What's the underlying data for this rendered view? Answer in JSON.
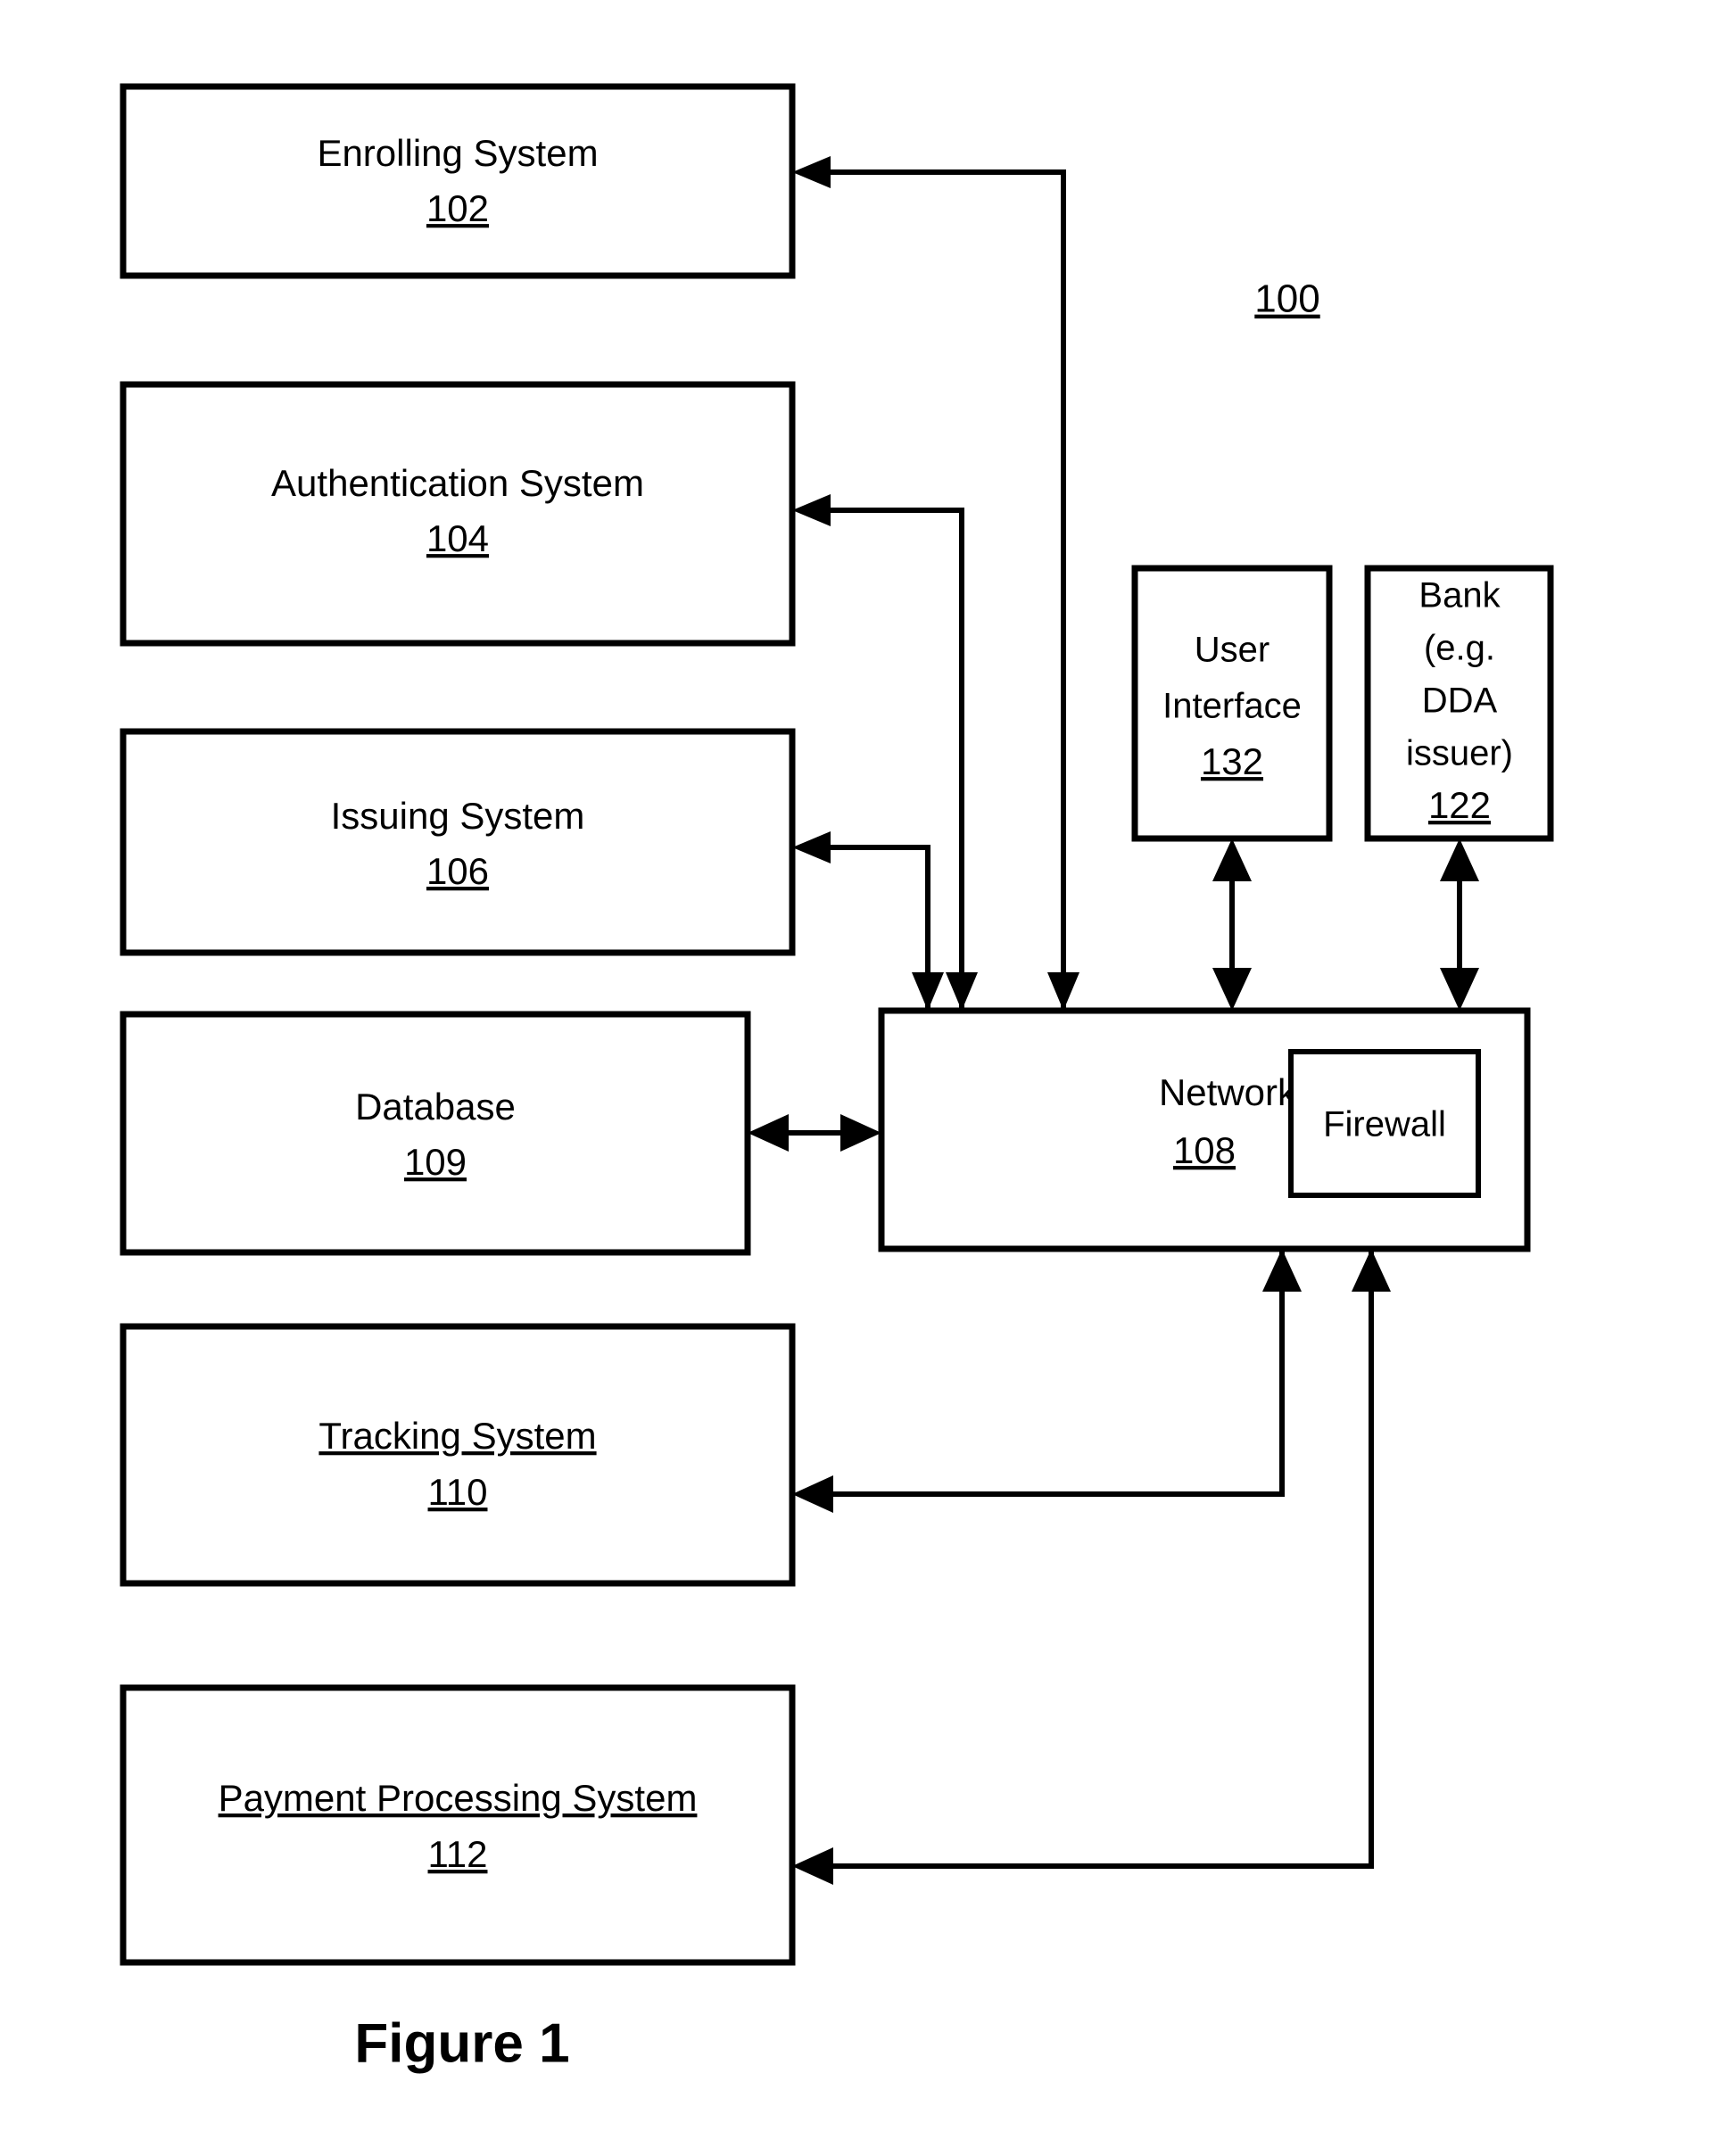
{
  "figure": {
    "caption": "Figure 1",
    "system_ref": "100"
  },
  "boxes": {
    "enrolling_system": {
      "label": "Enrolling System",
      "ref": "102",
      "underline_label": false
    },
    "authentication_system": {
      "label": "Authentication System",
      "ref": "104",
      "underline_label": false
    },
    "issuing_system": {
      "label": "Issuing System",
      "ref": "106",
      "underline_label": false
    },
    "database": {
      "label": "Database",
      "ref": "109",
      "underline_label": false
    },
    "tracking_system": {
      "label": "Tracking System",
      "ref": "110",
      "underline_label": true
    },
    "payment_processing_system": {
      "label": "Payment Processing System",
      "ref": "112",
      "underline_label": true
    },
    "user_interface": {
      "label_line1": "User",
      "label_line2": "Interface",
      "ref": "132"
    },
    "bank": {
      "label_line1": "Bank",
      "label_line2": "(e.g.",
      "label_line3": "DDA",
      "label_line4": "issuer)",
      "ref": "122"
    },
    "network": {
      "label": "Network",
      "ref": "108"
    },
    "firewall": {
      "label": "Firewall"
    }
  },
  "colors": {
    "stroke": "#000000",
    "background": "#ffffff"
  }
}
